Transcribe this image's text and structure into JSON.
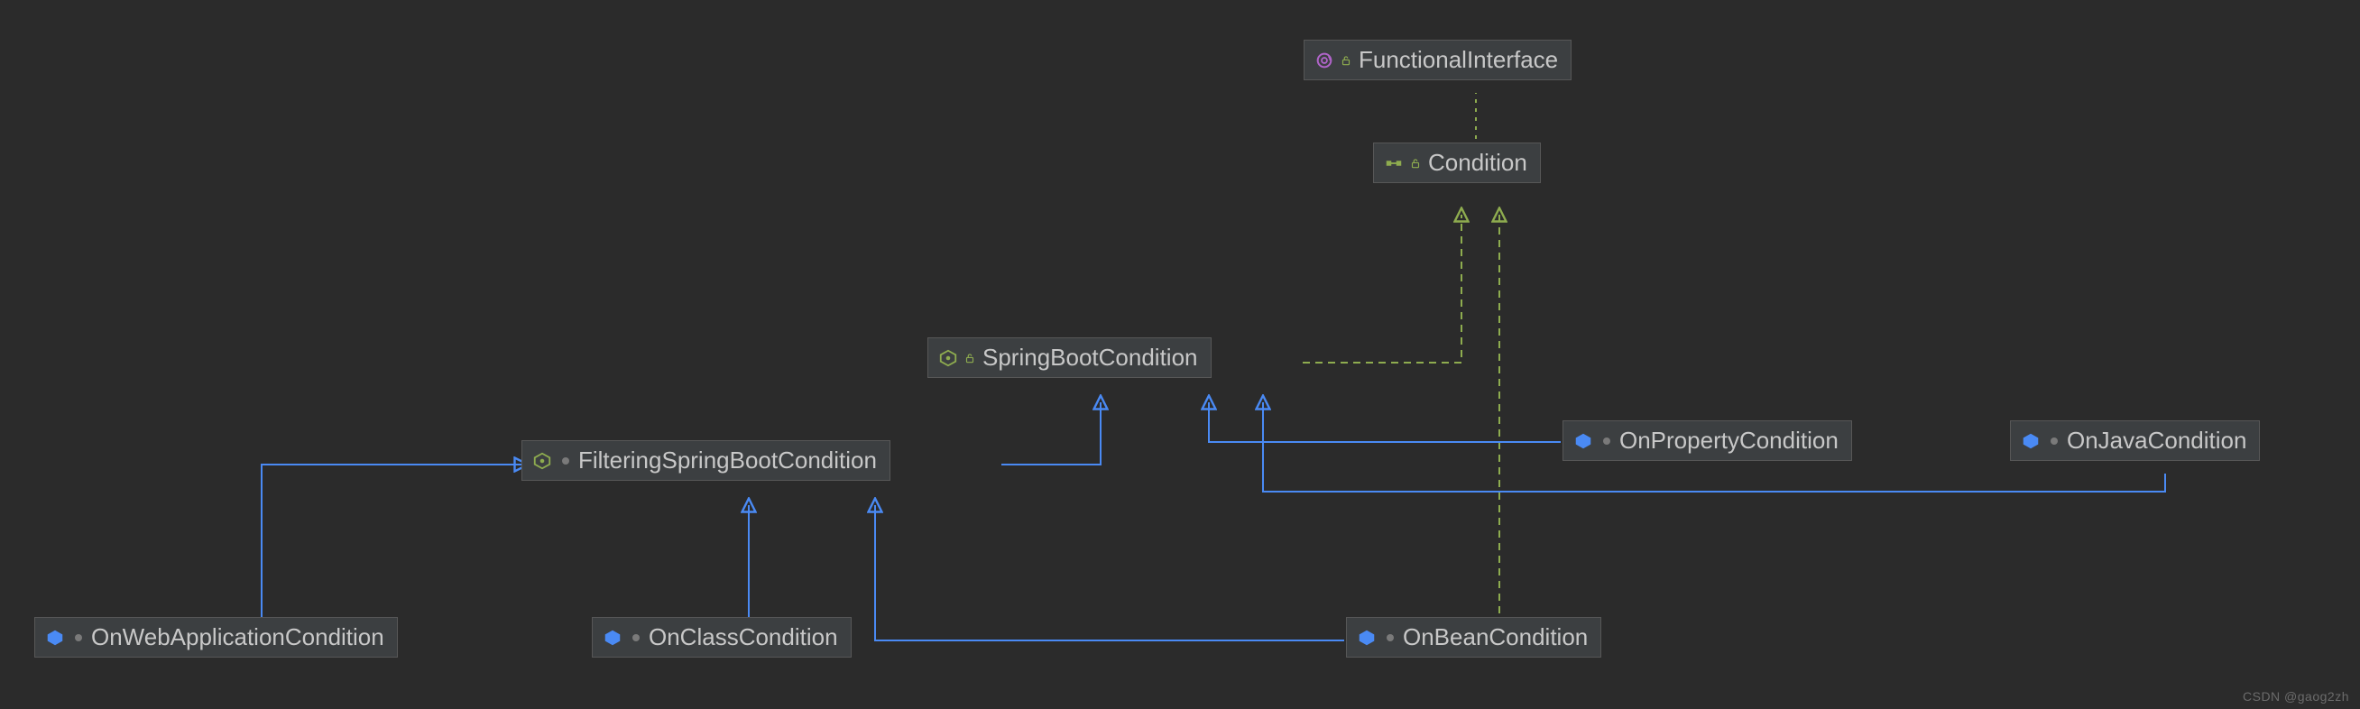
{
  "colors": {
    "bg": "#2b2b2b",
    "node_bg": "#3c3f41",
    "node_border": "#575757",
    "text": "#c8c8c8",
    "blue_line": "#4a8af4",
    "green_line": "#8eac4f",
    "class_icon": "#4a8af4",
    "interface_icon": "#8eac4f",
    "annotation_icon": "#b064c9",
    "abstract_icon": "#8eac4f",
    "lock_icon": "#8eac4f"
  },
  "nodes": {
    "functionalInterface": {
      "label": "FunctionalInterface",
      "kind": "annotation"
    },
    "condition": {
      "label": "Condition",
      "kind": "interface"
    },
    "springBootCondition": {
      "label": "SpringBootCondition",
      "kind": "abstract-class"
    },
    "filteringSpringBootCondition": {
      "label": "FilteringSpringBootCondition",
      "kind": "abstract-class"
    },
    "onPropertyCondition": {
      "label": "OnPropertyCondition",
      "kind": "class"
    },
    "onJavaCondition": {
      "label": "OnJavaCondition",
      "kind": "class"
    },
    "onWebApplicationCondition": {
      "label": "OnWebApplicationCondition",
      "kind": "class"
    },
    "onClassCondition": {
      "label": "OnClassCondition",
      "kind": "class"
    },
    "onBeanCondition": {
      "label": "OnBeanCondition",
      "kind": "class"
    }
  },
  "watermark": "CSDN @gaog2zh"
}
